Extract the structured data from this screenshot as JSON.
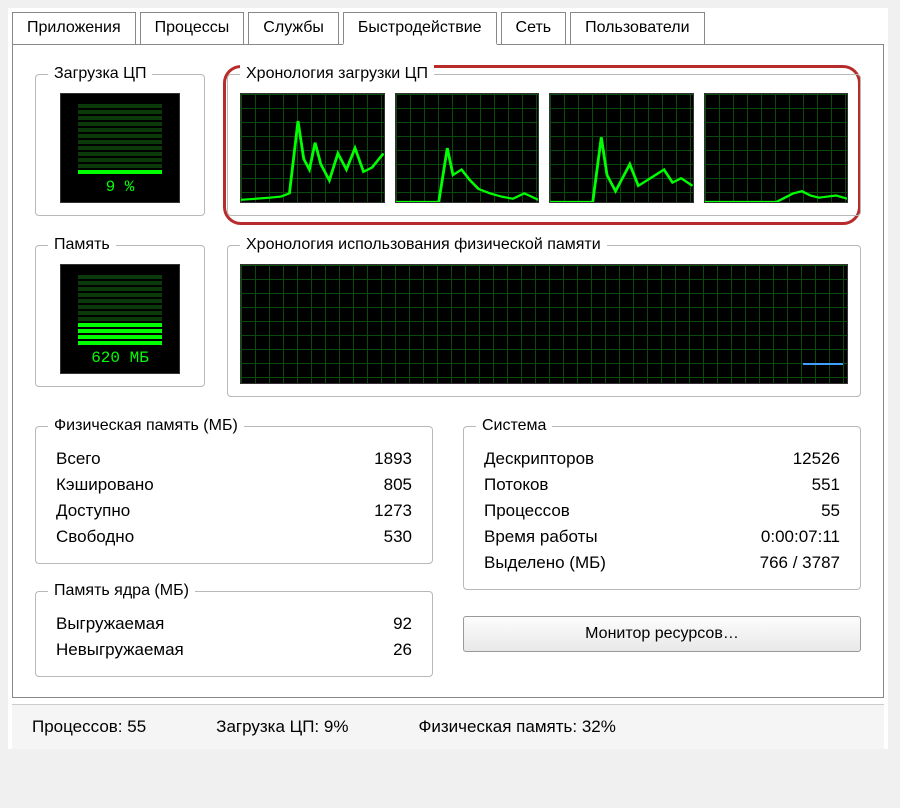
{
  "tabs": {
    "applications": "Приложения",
    "processes": "Процессы",
    "services": "Службы",
    "performance": "Быстродействие",
    "network": "Сеть",
    "users": "Пользователи",
    "active": "performance"
  },
  "groups": {
    "cpu_gauge": "Загрузка ЦП",
    "cpu_history": "Хронология загрузки ЦП",
    "mem_gauge": "Память",
    "mem_history": "Хронология использования физической памяти",
    "phys_mem": "Физическая память (МБ)",
    "kernel_mem": "Память ядра (МБ)",
    "system": "Система"
  },
  "gauges": {
    "cpu_value": "9 %",
    "mem_value": "620 МБ"
  },
  "phys_mem": {
    "total_label": "Всего",
    "total_value": "1893",
    "cached_label": "Кэшировано",
    "cached_value": "805",
    "avail_label": "Доступно",
    "avail_value": "1273",
    "free_label": "Свободно",
    "free_value": "530"
  },
  "kernel_mem": {
    "paged_label": "Выгружаемая",
    "paged_value": "92",
    "nonpaged_label": "Невыгружаемая",
    "nonpaged_value": "26"
  },
  "system": {
    "handles_label": "Дескрипторов",
    "handles_value": "12526",
    "threads_label": "Потоков",
    "threads_value": "551",
    "procs_label": "Процессов",
    "procs_value": "55",
    "uptime_label": "Время работы",
    "uptime_value": "0:00:07:11",
    "commit_label": "Выделено (МБ)",
    "commit_value": "766 / 3787"
  },
  "resource_button": "Монитор ресурсов…",
  "status": {
    "processes": "Процессов: 55",
    "cpu": "Загрузка ЦП: 9%",
    "mem": "Физическая память: 32%"
  },
  "colors": {
    "graph_line": "#00ff00",
    "graph_grid": "#0a4a0a",
    "highlight_ring": "#b82b2b"
  },
  "chart_data": [
    {
      "type": "line",
      "title": "CPU core 1 history",
      "ylim": [
        0,
        100
      ],
      "values": [
        2,
        3,
        2,
        4,
        3,
        5,
        8,
        6,
        75,
        40,
        30,
        55,
        35,
        20,
        45,
        30,
        25,
        50,
        28,
        32,
        40,
        45
      ]
    },
    {
      "type": "line",
      "title": "CPU core 2 history",
      "ylim": [
        0,
        100
      ],
      "values": [
        0,
        0,
        0,
        0,
        0,
        0,
        0,
        0,
        0,
        50,
        25,
        30,
        20,
        10,
        8,
        5,
        4,
        3,
        2,
        2,
        8,
        5,
        3,
        2
      ]
    },
    {
      "type": "line",
      "title": "CPU core 3 history",
      "ylim": [
        0,
        100
      ],
      "values": [
        0,
        0,
        0,
        0,
        0,
        0,
        0,
        0,
        0,
        60,
        25,
        10,
        20,
        35,
        15,
        20,
        25,
        30,
        18,
        22,
        20,
        15,
        12
      ]
    },
    {
      "type": "line",
      "title": "CPU core 4 history",
      "ylim": [
        0,
        100
      ],
      "values": [
        0,
        0,
        0,
        0,
        0,
        0,
        0,
        0,
        0,
        0,
        0,
        0,
        0,
        0,
        4,
        8,
        10,
        6,
        4,
        5,
        3,
        6,
        4,
        3
      ]
    },
    {
      "type": "line",
      "title": "Physical memory history",
      "ylim": [
        0,
        100
      ],
      "values": [
        15,
        15,
        15,
        15,
        15,
        15,
        15,
        15,
        15,
        15,
        15,
        15,
        15,
        15,
        15,
        15,
        15,
        15,
        15,
        15
      ]
    }
  ]
}
